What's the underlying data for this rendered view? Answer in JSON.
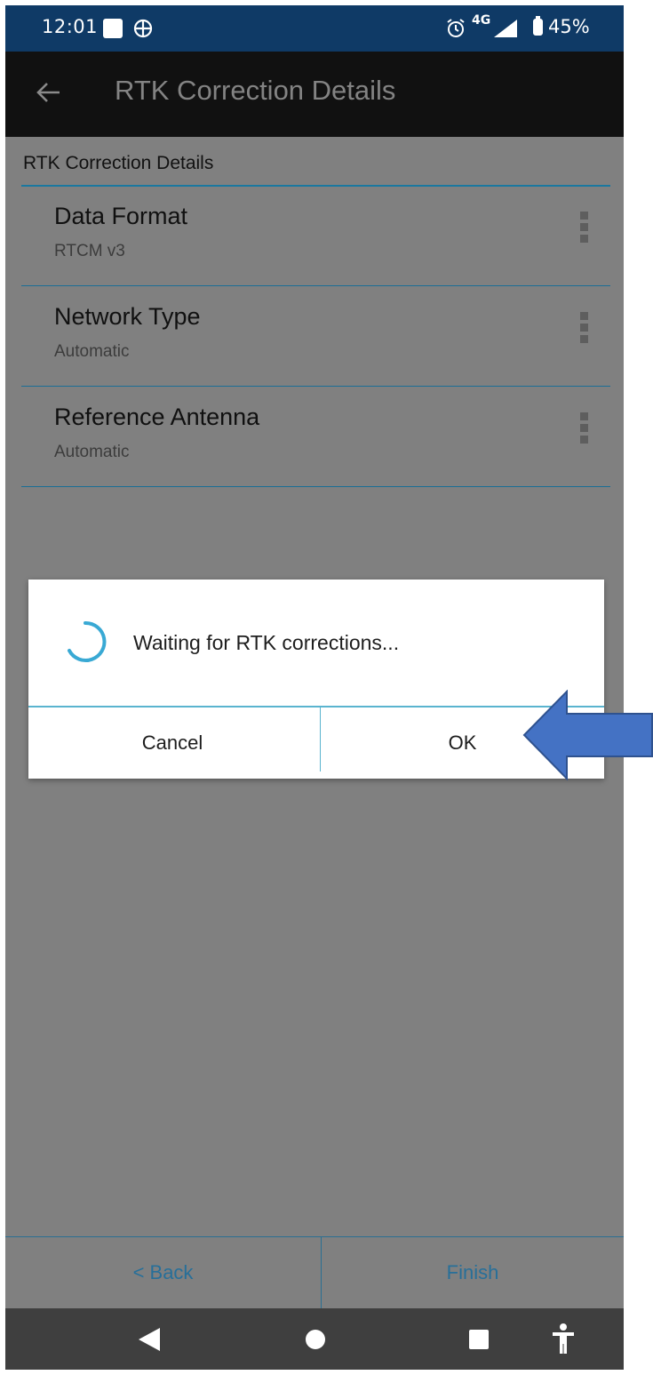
{
  "status_bar": {
    "time": "12:01",
    "network": "4G",
    "battery": "45%",
    "icons": [
      "stop-square-icon",
      "gps-target-icon",
      "alarm-icon",
      "signal-icon",
      "battery-icon"
    ]
  },
  "app_bar": {
    "back_icon": "back-arrow-icon",
    "title": "RTK Correction Details"
  },
  "section": {
    "header": "RTK Correction Details",
    "items": [
      {
        "label": "Data Format",
        "value": "RTCM v3"
      },
      {
        "label": "Network Type",
        "value": "Automatic"
      },
      {
        "label": "Reference Antenna",
        "value": "Automatic"
      }
    ]
  },
  "dialog": {
    "message": "Waiting for RTK corrections...",
    "cancel_label": "Cancel",
    "ok_label": "OK"
  },
  "footer": {
    "back_label": "< Back",
    "finish_label": "Finish"
  },
  "colors": {
    "status_bar": "#0f3a66",
    "accent": "#1a78a0",
    "spinner": "#39a9d4",
    "annotation_arrow": "#4472c4"
  }
}
